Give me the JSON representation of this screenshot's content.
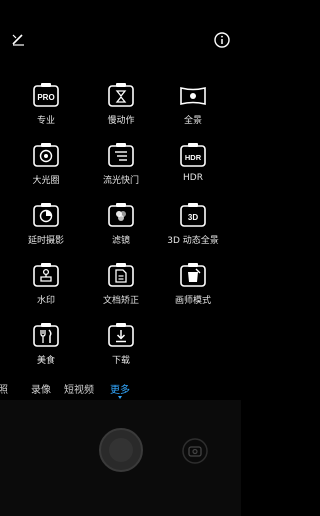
{
  "toolbar": {
    "edit_icon": "edit-icon",
    "info_icon": "info-icon"
  },
  "modes": [
    {
      "label": "专业",
      "icon": "pro-icon",
      "badge": "PRO"
    },
    {
      "label": "慢动作",
      "icon": "slow-motion-icon"
    },
    {
      "label": "全景",
      "icon": "panorama-icon"
    },
    {
      "label": "大光圈",
      "icon": "aperture-icon"
    },
    {
      "label": "流光快门",
      "icon": "light-painting-icon"
    },
    {
      "label": "HDR",
      "icon": "hdr-icon",
      "badge": "HDR"
    },
    {
      "label": "延时摄影",
      "icon": "time-lapse-icon"
    },
    {
      "label": "滤镜",
      "icon": "filter-icon"
    },
    {
      "label": "3D 动态全景",
      "icon": "3d-panorama-icon",
      "badge": "3D"
    },
    {
      "label": "水印",
      "icon": "watermark-icon"
    },
    {
      "label": "文档矫正",
      "icon": "document-correction-icon"
    },
    {
      "label": "画师模式",
      "icon": "artist-mode-icon"
    },
    {
      "label": "美食",
      "icon": "food-icon"
    },
    {
      "label": "下载",
      "icon": "download-icon"
    }
  ],
  "tabs": [
    {
      "label": "拍照"
    },
    {
      "label": "录像"
    },
    {
      "label": "短视频"
    },
    {
      "label": "更多"
    }
  ],
  "colors": {
    "accent": "#33a8ff",
    "background": "#000000"
  }
}
